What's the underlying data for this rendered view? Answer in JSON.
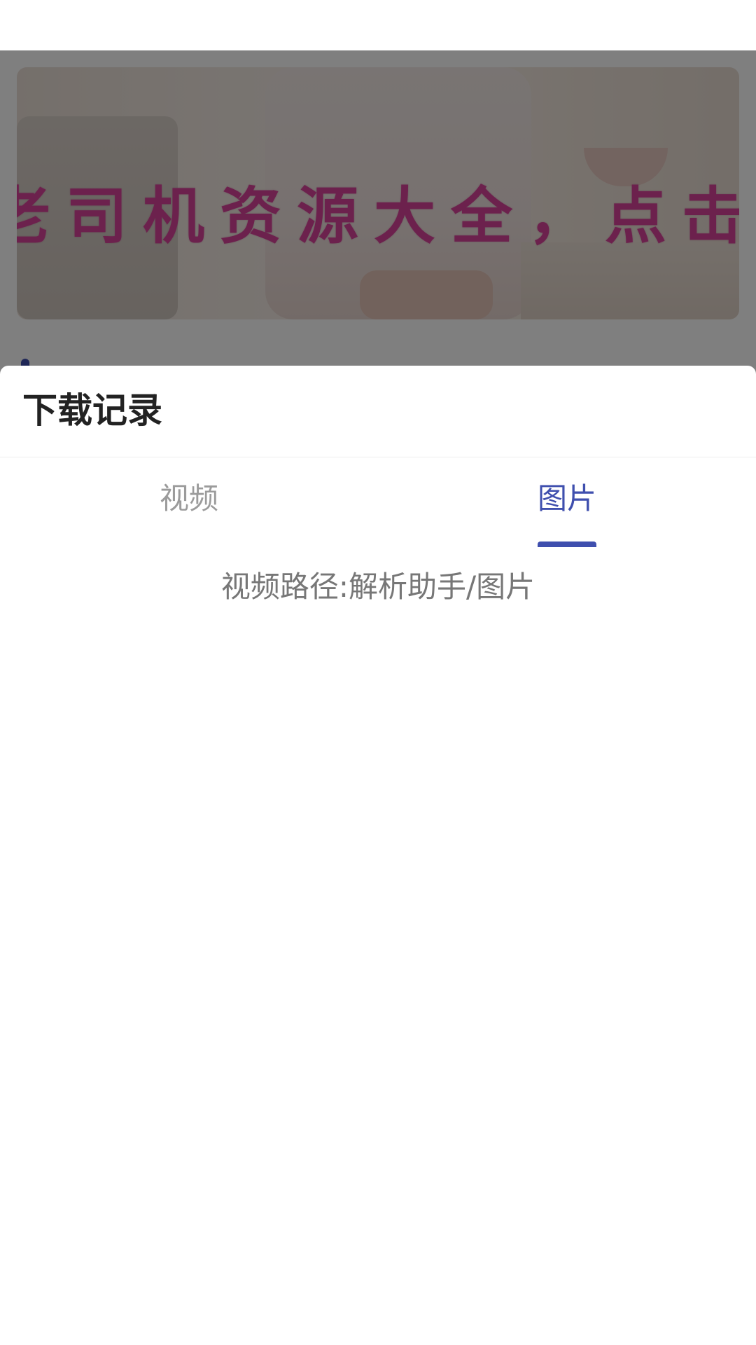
{
  "colors": {
    "accent": "#3f4fae",
    "banner_text": "#d9439a",
    "tab_inactive": "#9b9b9b",
    "title": "#222222",
    "path_text": "#777777",
    "overlay": "rgba(0,0,0,0.5)"
  },
  "banner": {
    "text": "老司机资源大全，点击下载"
  },
  "sheet": {
    "title": "下载记录",
    "tabs": [
      {
        "label": "视频",
        "active": false
      },
      {
        "label": "图片",
        "active": true
      }
    ],
    "path_text": "视频路径:解析助手/图片"
  }
}
